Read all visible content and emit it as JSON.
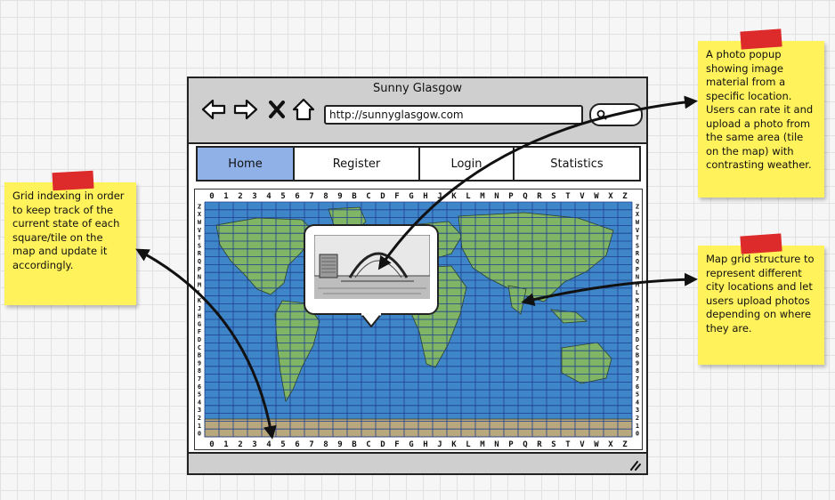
{
  "browser": {
    "title": "Sunny Glasgow",
    "url": "http://sunnyglasgow.com",
    "nav_icons": [
      "back-arrow-icon",
      "forward-arrow-icon",
      "stop-x-icon",
      "home-icon"
    ],
    "search_icon": "search-icon"
  },
  "menu": {
    "tabs": [
      {
        "label": "Home",
        "active": true
      },
      {
        "label": "Register",
        "active": false
      },
      {
        "label": "Login",
        "active": false
      },
      {
        "label": "Statistics",
        "active": false
      }
    ]
  },
  "map": {
    "columns": [
      "0",
      "1",
      "2",
      "3",
      "4",
      "5",
      "6",
      "7",
      "8",
      "9",
      "B",
      "C",
      "D",
      "F",
      "G",
      "H",
      "J",
      "K",
      "L",
      "M",
      "N",
      "P",
      "Q",
      "R",
      "S",
      "T",
      "V",
      "W",
      "X",
      "Z"
    ],
    "rows": [
      "Z",
      "X",
      "W",
      "V",
      "T",
      "S",
      "R",
      "Q",
      "P",
      "N",
      "M",
      "L",
      "K",
      "J",
      "H",
      "G",
      "F",
      "D",
      "C",
      "B",
      "9",
      "8",
      "7",
      "6",
      "5",
      "4",
      "3",
      "2",
      "1",
      "0"
    ]
  },
  "notes": {
    "left": "Grid indexing in order to keep track of the current state of each square/tile on the map and update it accordingly.",
    "top_right": "A photo popup showing image material from a specific location. Users can rate it and upload a photo from the same area (tile on the map) with contrasting weather.",
    "mid_right": "Map grid structure to represent different city locations and let users upload photos depending on where they are."
  },
  "colors": {
    "note": "#fff25a",
    "tape": "#dd2a2a",
    "active_tab": "#8fb1e8",
    "chrome": "#cfcfcf",
    "ocean": "#3f86c9",
    "land": "#7fb565"
  }
}
